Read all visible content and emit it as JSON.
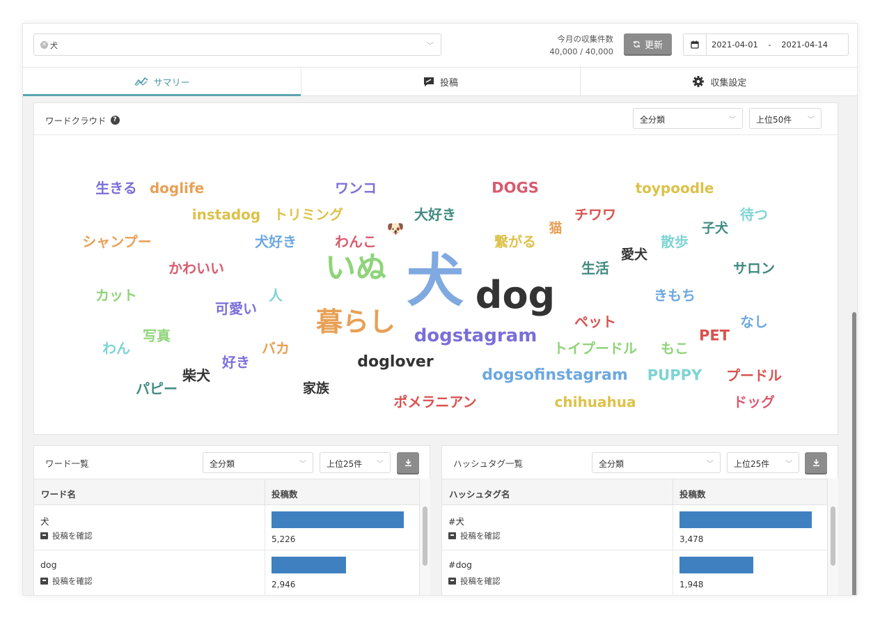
{
  "topbar": {
    "tag_chip": "犬",
    "count_label": "今月の収集件数",
    "count_value": "40,000 / 40,000",
    "refresh_label": "更新",
    "date_range": "2021-04-01    -    2021-04-14"
  },
  "tabs": [
    {
      "label": "サマリー",
      "icon": "chart-line-icon",
      "active": true
    },
    {
      "label": "投稿",
      "icon": "post-icon",
      "active": false
    },
    {
      "label": "収集設定",
      "icon": "gear-icon",
      "active": false
    }
  ],
  "wordcloud": {
    "title": "ワードクラウド",
    "filter": "全分類",
    "limit": "上位50件",
    "emoji": "🐶",
    "words": [
      {
        "text": "生きる",
        "color": "#7a6fd8",
        "size": 20
      },
      {
        "text": "doglife",
        "color": "#e8a055",
        "size": 20
      },
      {
        "text": "ワンコ",
        "color": "#7a6fd8",
        "size": 20
      },
      {
        "text": "DOGS",
        "color": "#d95b6e",
        "size": 21
      },
      {
        "text": "toypoodle",
        "color": "#dcc24a",
        "size": 20
      },
      {
        "text": "instadog",
        "color": "#dcc24a",
        "size": 20
      },
      {
        "text": "トリミング",
        "color": "#dcc24a",
        "size": 20
      },
      {
        "text": "大好き",
        "color": "#3f8a7f",
        "size": 20
      },
      {
        "text": "チワワ",
        "color": "#d9534f",
        "size": 20
      },
      {
        "text": "待つ",
        "color": "#7fd4d4",
        "size": 20
      },
      {
        "text": "猫",
        "color": "#e8a055",
        "size": 19
      },
      {
        "text": "子犬",
        "color": "#3f8a7f",
        "size": 19
      },
      {
        "text": "シャンプー",
        "color": "#e8a055",
        "size": 20
      },
      {
        "text": "犬好き",
        "color": "#6da8e0",
        "size": 20
      },
      {
        "text": "わんこ",
        "color": "#d95b6e",
        "size": 20
      },
      {
        "text": "繋がる",
        "color": "#dcc24a",
        "size": 20
      },
      {
        "text": "散歩",
        "color": "#7fd4d4",
        "size": 20
      },
      {
        "text": "愛犬",
        "color": "#333333",
        "size": 19
      },
      {
        "text": "かわいい",
        "color": "#d95b6e",
        "size": 20
      },
      {
        "text": "いぬ",
        "color": "#8fd47a",
        "size": 44
      },
      {
        "text": "犬",
        "color": "#7fa9e0",
        "size": 82
      },
      {
        "text": "dog",
        "color": "#333333",
        "size": 54
      },
      {
        "text": "生活",
        "color": "#3f8a7f",
        "size": 20
      },
      {
        "text": "サロン",
        "color": "#3f8a7f",
        "size": 20
      },
      {
        "text": "カット",
        "color": "#8fd47a",
        "size": 20
      },
      {
        "text": "人",
        "color": "#7fd4d4",
        "size": 20
      },
      {
        "text": "可愛い",
        "color": "#7a6fd8",
        "size": 20
      },
      {
        "text": "きもち",
        "color": "#6da8e0",
        "size": 20
      },
      {
        "text": "暮らし",
        "color": "#e8a055",
        "size": 38
      },
      {
        "text": "ペット",
        "color": "#d9534f",
        "size": 20
      },
      {
        "text": "なし",
        "color": "#6da8e0",
        "size": 20
      },
      {
        "text": "写真",
        "color": "#8fd47a",
        "size": 20
      },
      {
        "text": "dogstagram",
        "color": "#7a6fd8",
        "size": 26
      },
      {
        "text": "PET",
        "color": "#d9534f",
        "size": 21
      },
      {
        "text": "わん",
        "color": "#7fd4d4",
        "size": 20
      },
      {
        "text": "バカ",
        "color": "#e8a055",
        "size": 20
      },
      {
        "text": "トイプードル",
        "color": "#8fd47a",
        "size": 20
      },
      {
        "text": "もこ",
        "color": "#8fd47a",
        "size": 20
      },
      {
        "text": "好き",
        "color": "#7a6fd8",
        "size": 20
      },
      {
        "text": "doglover",
        "color": "#333333",
        "size": 22
      },
      {
        "text": "柴犬",
        "color": "#333333",
        "size": 20
      },
      {
        "text": "dogsofinstagram",
        "color": "#6da8e0",
        "size": 22
      },
      {
        "text": "PUPPY",
        "color": "#7fd4d4",
        "size": 21
      },
      {
        "text": "プードル",
        "color": "#d9534f",
        "size": 20
      },
      {
        "text": "パピー",
        "color": "#3f8a7f",
        "size": 20
      },
      {
        "text": "家族",
        "color": "#333333",
        "size": 19
      },
      {
        "text": "ポメラニアン",
        "color": "#d9534f",
        "size": 20
      },
      {
        "text": "chihuahua",
        "color": "#dcc24a",
        "size": 20
      },
      {
        "text": "ドッグ",
        "color": "#d95b6e",
        "size": 20
      }
    ]
  },
  "word_list": {
    "title": "ワード一覧",
    "filter": "全分類",
    "limit": "上位25件",
    "col_name": "ワード名",
    "col_count": "投稿数",
    "link_label": "投稿を確認",
    "rows": [
      {
        "name": "犬",
        "count": "5,226",
        "value": 5226
      },
      {
        "name": "dog",
        "count": "2,946",
        "value": 2946
      }
    ]
  },
  "hashtag_list": {
    "title": "ハッシュタグ一覧",
    "filter": "全分類",
    "limit": "上位25件",
    "col_name": "ハッシュタグ名",
    "col_count": "投稿数",
    "link_label": "投稿を確認",
    "rows": [
      {
        "name": "#犬",
        "count": "3,478",
        "value": 3478
      },
      {
        "name": "#dog",
        "count": "1,948",
        "value": 1948
      }
    ]
  },
  "colors": {
    "accent": "#5aa3b3",
    "bar": "#3f80c0",
    "button": "#8c8c8c"
  }
}
